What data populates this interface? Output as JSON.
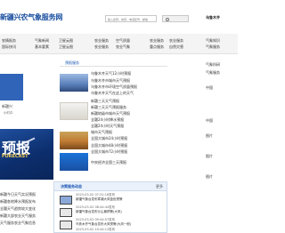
{
  "header": {
    "logo_text": "新疆兴农气象服务网",
    "search_placeholder": "输入名称、拼音、电话区号、邮编",
    "city_link": "乌鲁木齐"
  },
  "nav": {
    "col1": [
      "农情报务",
      "国际快讯"
    ],
    "col2": [
      "气象新闻",
      "基本要素"
    ],
    "col3": [
      "卫星云图",
      "卫星云图"
    ],
    "col4": [
      "农业服务",
      "农业服务"
    ],
    "col5": [
      "空气质量",
      "农业气象"
    ],
    "col6": [
      "农业服务",
      "重点服务"
    ],
    "col7": [
      "农业服务",
      "自然灾害"
    ],
    "col8": [
      "气象知识",
      "气象服务"
    ]
  },
  "left": {
    "text1": "新疆兴",
    "text2": "小时中",
    "banner_title": "预报",
    "banner_sub": "FORECAST",
    "news": [
      "新疆今日天气实况预报",
      "新疆各地降水预报发布",
      "全疆天气趋势较大变化",
      "新疆大部农业天气服务",
      "天气服务农业气象信息"
    ]
  },
  "middle": {
    "tab_label": "预报服务",
    "list": [
      "乌鲁木齐天气12小时预报",
      "乌鲁木齐市城市天气预报",
      "乌鲁木齐市环境空气质量预报",
      "乌鲁木齐天气在这上的天气",
      "新疆三天天气预报",
      "新疆三天天气预报服务",
      "新疆地级市城市天气预报",
      "全疆24小时降水预报",
      "全疆24小时天气预报",
      "城市天气预报",
      "全国大城市24小时预报",
      "全国大城市48小时预报",
      "全国大城市72小时预报",
      "中央经济全国三天预报"
    ]
  },
  "right": {
    "items": [
      "气象科研",
      "气象服务",
      "中国",
      "中国",
      "图片",
      "图片",
      "图片"
    ]
  },
  "panel": {
    "title": "决策服务动态",
    "more": "更多",
    "entries": [
      {
        "date": "2023-03-02 07:31:16发布",
        "text": "新疆气象台发布寒潮大风蓝色预警"
      },
      {
        "date": "2023-03-02 08:44:44发布",
        "text": "新疆气象台发布沙尘暴预警(大风)"
      },
      {
        "date": "2023-03-02 09:44:57发布",
        "text": "乌鲁木齐气象台发布大风预警(大风一般)"
      },
      {
        "date": "2023-03-02 10:44:13发布",
        "text": "新疆气象台天气预报服务"
      }
    ]
  },
  "colors": {
    "brand": "#1a4fa0",
    "nav_bg": "#f4f4f4",
    "panel_head": "#eaf1fb"
  }
}
